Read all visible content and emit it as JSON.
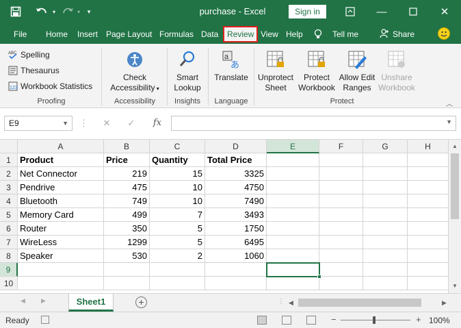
{
  "window": {
    "title": "purchase  -  Excel",
    "sign_in": "Sign in"
  },
  "menu": {
    "tabs": [
      "File",
      "Home",
      "Insert",
      "Page Layout",
      "Formulas",
      "Data",
      "Review",
      "View",
      "Help"
    ],
    "active_tab": "Review",
    "tell_me": "Tell me",
    "share": "Share"
  },
  "ribbon": {
    "proofing": {
      "spelling": "Spelling",
      "thesaurus": "Thesaurus",
      "workbook_statistics": "Workbook Statistics",
      "label": "Proofing"
    },
    "accessibility": {
      "check_line1": "Check",
      "check_line2": "Accessibility",
      "label": "Accessibility"
    },
    "insights": {
      "smart_line1": "Smart",
      "smart_line2": "Lookup",
      "label": "Insights"
    },
    "language": {
      "translate": "Translate",
      "label": "Language"
    },
    "protect": {
      "unprotect_line1": "Unprotect",
      "unprotect_line2": "Sheet",
      "protect_wb_line1": "Protect",
      "protect_wb_line2": "Workbook",
      "allow_edit_line1": "Allow Edit",
      "allow_edit_line2": "Ranges",
      "unshare_line1": "Unshare",
      "unshare_line2": "Workbook",
      "label": "Protect"
    }
  },
  "formula_bar": {
    "name_box": "E9",
    "fx": "fx",
    "cancel": "✕",
    "confirm": "✓",
    "value": ""
  },
  "sheet": {
    "columns": [
      "A",
      "B",
      "C",
      "D",
      "E",
      "F",
      "G",
      "H"
    ],
    "rows": [
      "1",
      "2",
      "3",
      "4",
      "5",
      "6",
      "7",
      "8",
      "9",
      "10"
    ],
    "header": [
      "Product",
      "Price",
      "Quantity",
      "Total Price"
    ],
    "data": [
      [
        "Net Connector",
        "219",
        "15",
        "3325"
      ],
      [
        "Pendrive",
        "475",
        "10",
        "4750"
      ],
      [
        "Bluetooth",
        "749",
        "10",
        "7490"
      ],
      [
        "Memory Card",
        "499",
        "7",
        "3493"
      ],
      [
        "Router",
        "350",
        "5",
        "1750"
      ],
      [
        "WireLess",
        "1299",
        "5",
        "6495"
      ],
      [
        "Speaker",
        "530",
        "2",
        "1060"
      ]
    ],
    "selected_cell": "E9"
  },
  "sheet_tabs": {
    "active": "Sheet1",
    "add": "+"
  },
  "status": {
    "ready": "Ready",
    "zoom": "100%",
    "zoom_minus": "−",
    "zoom_plus": "+"
  },
  "colors": {
    "excel_green": "#217346",
    "highlight_red": "#e0201b"
  }
}
